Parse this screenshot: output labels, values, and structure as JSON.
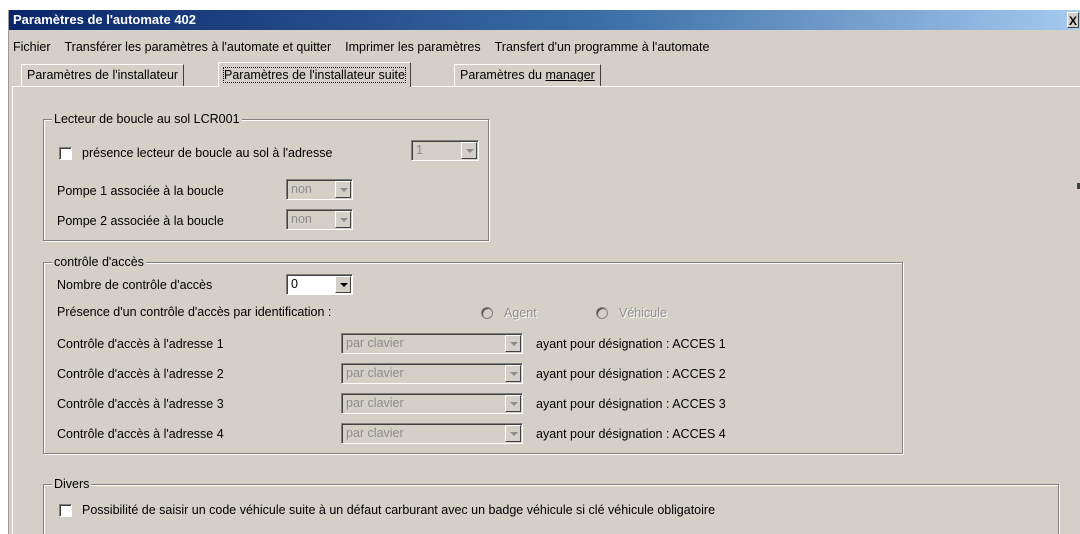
{
  "window": {
    "title": "Paramètres de l'automate 402",
    "close_glyph": "X"
  },
  "menu": {
    "file": "Fichier",
    "transfer_quit": "Transférer les paramètres à l'automate et quitter",
    "print": "Imprimer les paramètres",
    "transfer_program": "Transfert d'un programme à l'automate"
  },
  "tabs": {
    "installer": "Paramètres de l'installateur",
    "installer_cont": "Paramètres de l'installateur suite",
    "manager_pre": "Paramètres du ",
    "manager_u": "manager"
  },
  "loop_reader": {
    "legend": "Lecteur de boucle au sol LCR001",
    "presence_label": "présence lecteur de boucle au sol à l'adresse",
    "presence_checked": false,
    "address_value": "1",
    "pump1_label": "Pompe 1 associée à la boucle",
    "pump1_value": "non",
    "pump2_label": "Pompe 2 associée à la boucle",
    "pump2_value": "non"
  },
  "access": {
    "legend": "contrôle d'accès",
    "count_label": "Nombre de contrôle d'accès",
    "count_value": "0",
    "ident_label": "Présence d'un contrôle d'accès par identification :",
    "radio_agent": "Agent",
    "radio_vehicle": "Véhicule",
    "rows": [
      {
        "label": "Contrôle d'accès à l'adresse 1",
        "mode": "par clavier",
        "designation": "ayant pour désignation : ACCES 1"
      },
      {
        "label": "Contrôle d'accès à l'adresse 2",
        "mode": "par clavier",
        "designation": "ayant pour désignation : ACCES 2"
      },
      {
        "label": "Contrôle d'accès à l'adresse 3",
        "mode": "par clavier",
        "designation": "ayant pour désignation : ACCES 3"
      },
      {
        "label": "Contrôle d'accès à l'adresse 4",
        "mode": "par clavier",
        "designation": "ayant pour désignation : ACCES 4"
      }
    ]
  },
  "misc": {
    "legend": "Divers",
    "vehicle_code_label": "Possibilité de saisir un code véhicule suite à un défaut carburant avec un badge véhicule si clé véhicule obligatoire",
    "vehicle_code_checked": false
  },
  "colors": {
    "face": "#d4d0c8",
    "title_start": "#0a246a",
    "title_end": "#a6caf0",
    "disabled_text": "#8c8c8c"
  }
}
